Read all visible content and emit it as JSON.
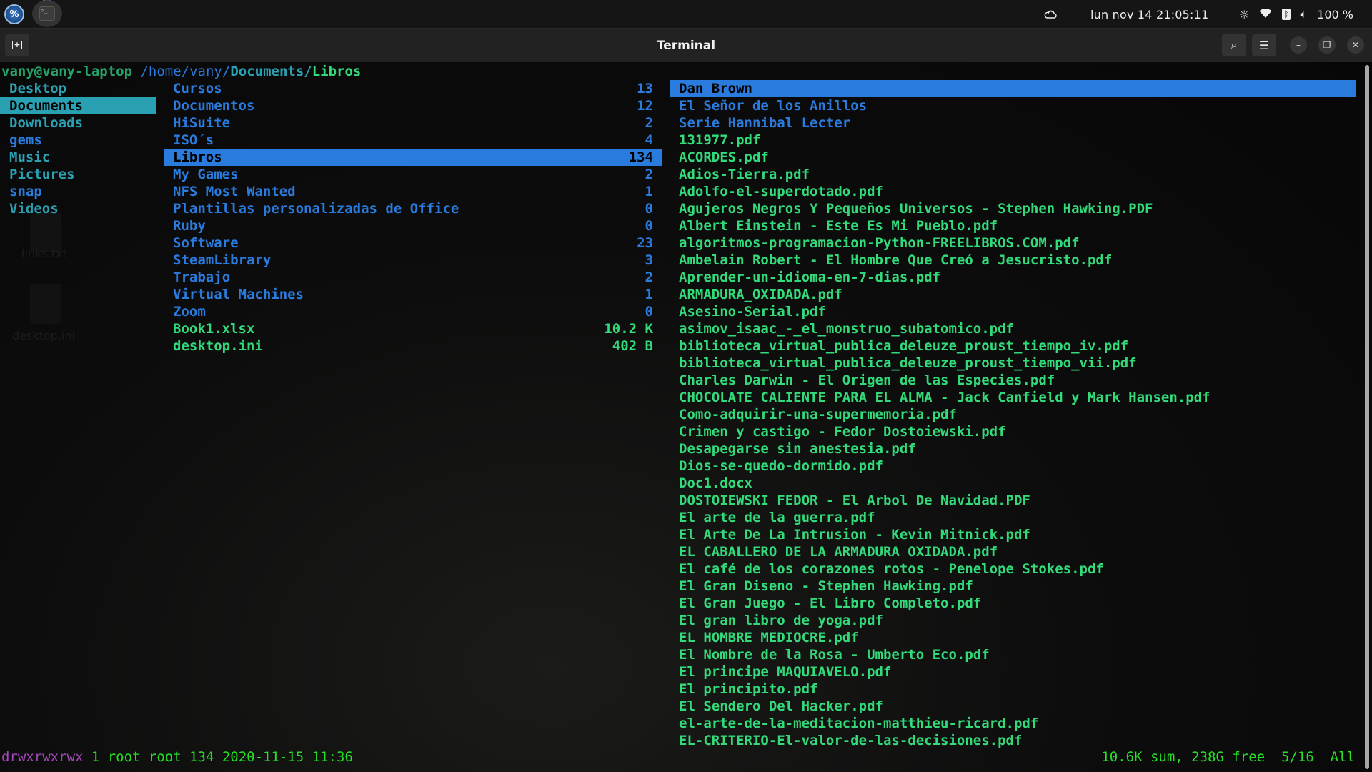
{
  "topbar": {
    "app_logo_label": "%",
    "terminal_app_glyph": ">_",
    "clock": "lun nov 14  21:05:11",
    "battery": "100 %",
    "icons": [
      "weather-icon",
      "night-light-icon",
      "wifi-icon",
      "bluetooth-icon",
      "volume-icon"
    ]
  },
  "window": {
    "title": "Terminal",
    "newtab_glyph": "+",
    "search_glyph": "⌕",
    "menu_glyph": "☰",
    "minimize_glyph": "–",
    "maximize_glyph": "❐",
    "close_glyph": "✕"
  },
  "desktop_icons": [
    {
      "label": "links.txt"
    },
    {
      "label": "desktop.ini"
    }
  ],
  "prompt": {
    "user_host": "vany@vany-laptop",
    "path_prefix": " /home/vany/",
    "path_parent": "Documents/",
    "path_current": "Libros"
  },
  "left_column": [
    {
      "name": "Desktop",
      "color": "teal"
    },
    {
      "name": "Documents",
      "color": "teal",
      "selected": true
    },
    {
      "name": "Downloads",
      "color": "teal"
    },
    {
      "name": "gems",
      "color": "blue"
    },
    {
      "name": "Music",
      "color": "teal"
    },
    {
      "name": "Pictures",
      "color": "teal"
    },
    {
      "name": "snap",
      "color": "blue"
    },
    {
      "name": "Videos",
      "color": "teal"
    }
  ],
  "middle_column": [
    {
      "name": "Cursos",
      "size": "13",
      "color": "blue"
    },
    {
      "name": "Documentos",
      "size": "12",
      "color": "blue"
    },
    {
      "name": "HiSuite",
      "size": "2",
      "color": "blue"
    },
    {
      "name": "ISO´s",
      "size": "4",
      "color": "blue"
    },
    {
      "name": "Libros",
      "size": "134",
      "color": "blue",
      "selected": true
    },
    {
      "name": "My Games",
      "size": "2",
      "color": "blue"
    },
    {
      "name": "NFS Most Wanted",
      "size": "1",
      "color": "blue"
    },
    {
      "name": "Plantillas personalizadas de Office",
      "size": "0",
      "color": "blue"
    },
    {
      "name": "Ruby",
      "size": "0",
      "color": "blue"
    },
    {
      "name": "Software",
      "size": "23",
      "color": "blue"
    },
    {
      "name": "SteamLibrary",
      "size": "3",
      "color": "blue"
    },
    {
      "name": "Trabajo",
      "size": "2",
      "color": "blue"
    },
    {
      "name": "Virtual Machines",
      "size": "1",
      "color": "blue"
    },
    {
      "name": "Zoom",
      "size": "0",
      "color": "blue"
    },
    {
      "name": "Book1.xlsx",
      "size": "10.2 K",
      "color": "green"
    },
    {
      "name": "desktop.ini",
      "size": "402 B",
      "color": "green"
    }
  ],
  "right_column": [
    {
      "name": "Dan Brown",
      "color": "blue",
      "selected": true
    },
    {
      "name": "El Señor de los Anillos",
      "color": "blue"
    },
    {
      "name": "Serie Hannibal Lecter",
      "color": "blue"
    },
    {
      "name": "131977.pdf",
      "color": "green"
    },
    {
      "name": "ACORDES.pdf",
      "color": "green"
    },
    {
      "name": "Adios-Tierra.pdf",
      "color": "green"
    },
    {
      "name": "Adolfo-el-superdotado.pdf",
      "color": "green"
    },
    {
      "name": "Agujeros Negros Y Pequeños Universos - Stephen Hawking.PDF",
      "color": "green"
    },
    {
      "name": "Albert Einstein - Este Es Mi Pueblo.pdf",
      "color": "green"
    },
    {
      "name": "algoritmos-programacion-Python-FREELIBROS.COM.pdf",
      "color": "green"
    },
    {
      "name": "Ambelain Robert - El Hombre Que Creó a Jesucristo.pdf",
      "color": "green"
    },
    {
      "name": "Aprender-un-idioma-en-7-dias.pdf",
      "color": "green"
    },
    {
      "name": "ARMADURA_OXIDADA.pdf",
      "color": "green"
    },
    {
      "name": "Asesino-Serial.pdf",
      "color": "green"
    },
    {
      "name": "asimov_isaac_-_el_monstruo_subatomico.pdf",
      "color": "green"
    },
    {
      "name": "biblioteca_virtual_publica_deleuze_proust_tiempo_iv.pdf",
      "color": "green"
    },
    {
      "name": "biblioteca_virtual_publica_deleuze_proust_tiempo_vii.pdf",
      "color": "green"
    },
    {
      "name": "Charles Darwin - El Origen de las Especies.pdf",
      "color": "green"
    },
    {
      "name": "CHOCOLATE CALIENTE PARA EL ALMA - Jack Canfield y Mark Hansen.pdf",
      "color": "green"
    },
    {
      "name": "Como-adquirir-una-supermemoria.pdf",
      "color": "green"
    },
    {
      "name": "Crimen y castigo - Fedor Dostoiewski.pdf",
      "color": "green"
    },
    {
      "name": "Desapegarse sin anestesia.pdf",
      "color": "green"
    },
    {
      "name": "Dios-se-quedo-dormido.pdf",
      "color": "green"
    },
    {
      "name": "Doc1.docx",
      "color": "green"
    },
    {
      "name": "DOSTOIEWSKI FEDOR - El Arbol De Navidad.PDF",
      "color": "green"
    },
    {
      "name": "El arte de la guerra.pdf",
      "color": "green"
    },
    {
      "name": "El Arte De La Intrusion - Kevin Mitnick.pdf",
      "color": "green"
    },
    {
      "name": "EL CABALLERO DE LA ARMADURA OXIDADA.pdf",
      "color": "green"
    },
    {
      "name": "El café de los corazones rotos - Penelope Stokes.pdf",
      "color": "green"
    },
    {
      "name": "El Gran Diseno - Stephen Hawking.pdf",
      "color": "green"
    },
    {
      "name": "El Gran Juego - El Libro Completo.pdf",
      "color": "green"
    },
    {
      "name": "El gran libro de yoga.pdf",
      "color": "green"
    },
    {
      "name": "EL HOMBRE MEDIOCRE.pdf",
      "color": "green"
    },
    {
      "name": "El Nombre de la Rosa - Umberto Eco.pdf",
      "color": "green"
    },
    {
      "name": "El principe MAQUIAVELO.pdf",
      "color": "green"
    },
    {
      "name": "El principito.pdf",
      "color": "green"
    },
    {
      "name": "El Sendero Del Hacker.pdf",
      "color": "green"
    },
    {
      "name": "el-arte-de-la-meditacion-matthieu-ricard.pdf",
      "color": "green"
    },
    {
      "name": "EL-CRITERIO-El-valor-de-las-decisiones.pdf",
      "color": "green"
    }
  ],
  "statusbar": {
    "permissions": "drwxrwxrwx",
    "details": " 1 root root 134 2020-11-15 11:36",
    "disk": "10.6K sum, 238G free",
    "position": "5/16",
    "scroll": "All"
  },
  "colors": {
    "teal": "#2aa1b3",
    "blue": "#2a7bde",
    "green": "#33da7a",
    "status_green": "#26e026",
    "permissions": "#a347ba"
  }
}
